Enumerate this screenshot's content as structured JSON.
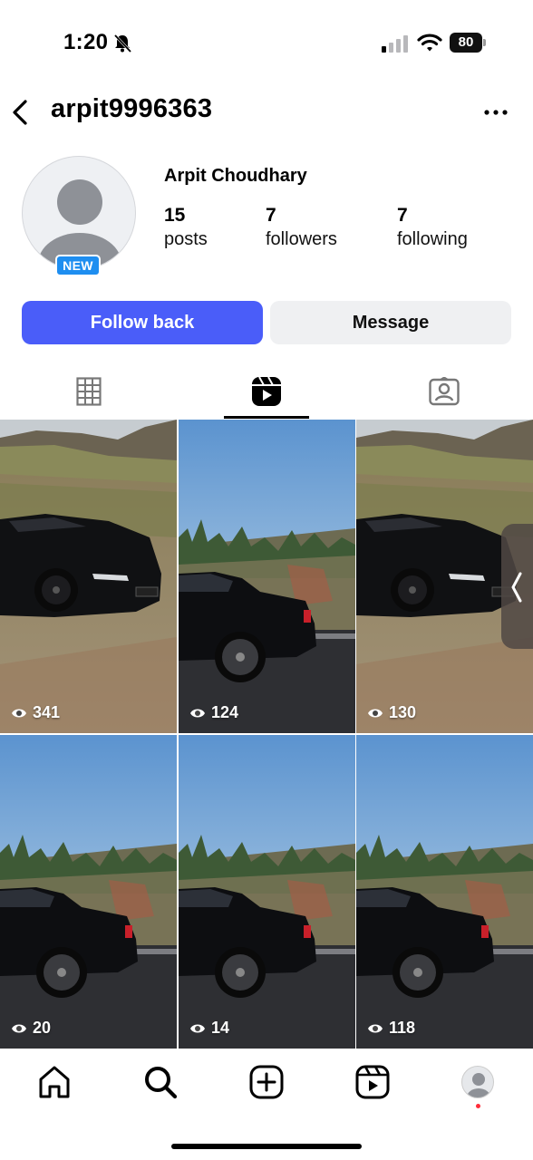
{
  "status_bar": {
    "time": "1:20",
    "battery": "80"
  },
  "header": {
    "username": "arpit9996363"
  },
  "profile": {
    "full_name": "Arpit Choudhary",
    "badge": "NEW",
    "stats": [
      {
        "value": "15",
        "label": "posts"
      },
      {
        "value": "7",
        "label": "followers"
      },
      {
        "value": "7",
        "label": "following"
      }
    ]
  },
  "actions": {
    "follow_label": "Follow back",
    "message_label": "Message"
  },
  "tabs": [
    {
      "icon": "grid-icon",
      "active": false
    },
    {
      "icon": "reels-icon",
      "active": true
    },
    {
      "icon": "tagged-icon",
      "active": false
    }
  ],
  "reels": [
    {
      "views": "341",
      "scene": "black sports convertible on dry hillside"
    },
    {
      "views": "124",
      "scene": "black sedan rear by pine trees"
    },
    {
      "views": "130",
      "scene": "black sports convertible on dry hillside"
    },
    {
      "views": "20",
      "scene": "black sedan rear by pine trees"
    },
    {
      "views": "14",
      "scene": "black sedan rear by pine trees"
    },
    {
      "views": "118",
      "scene": "black sedan rear by pine trees"
    }
  ],
  "bottom_nav": [
    {
      "icon": "home-icon"
    },
    {
      "icon": "search-icon"
    },
    {
      "icon": "create-icon"
    },
    {
      "icon": "reels-nav-icon"
    },
    {
      "icon": "profile-avatar"
    }
  ],
  "colors": {
    "accent": "#4a5df9",
    "badge": "#1e8ef0",
    "notification_dot": "#ff2d3a"
  }
}
